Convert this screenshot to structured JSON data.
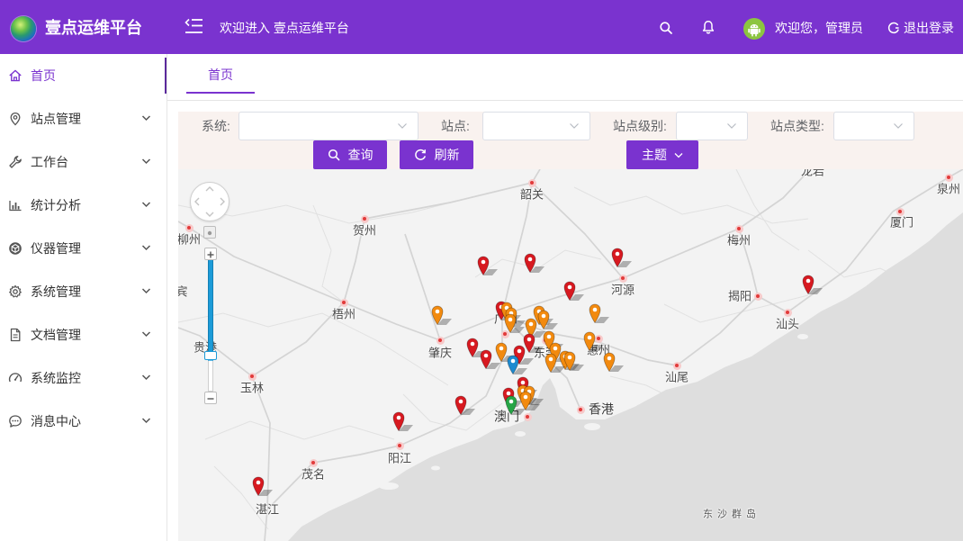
{
  "header": {
    "app_title": "壹点运维平台",
    "welcome_text": "欢迎进入 壹点运维平台",
    "greeting": "欢迎您，管理员",
    "logout_label": "退出登录",
    "icons": {
      "logo": "globe-logo",
      "menu": "menu-toggle-icon",
      "search": "search-icon",
      "notifications": "bell-icon",
      "avatar": "android-avatar",
      "logout": "logout-icon"
    }
  },
  "sidebar": {
    "items": [
      {
        "label": "首页",
        "icon": "home-icon",
        "active": true
      },
      {
        "label": "站点管理",
        "icon": "location-icon"
      },
      {
        "label": "工作台",
        "icon": "wrench-icon"
      },
      {
        "label": "统计分析",
        "icon": "bar-chart-icon"
      },
      {
        "label": "仪器管理",
        "icon": "instrument-icon"
      },
      {
        "label": "系统管理",
        "icon": "gear-icon"
      },
      {
        "label": "文档管理",
        "icon": "document-icon"
      },
      {
        "label": "系统监控",
        "icon": "gauge-icon"
      },
      {
        "label": "消息中心",
        "icon": "chat-icon"
      }
    ]
  },
  "tabs": [
    {
      "label": "首页",
      "active": true
    }
  ],
  "filters": {
    "system": {
      "label": "系统:"
    },
    "station": {
      "label": "站点:"
    },
    "station_level": {
      "label": "站点级别:"
    },
    "station_type": {
      "label": "站点类型:"
    }
  },
  "buttons": {
    "query": "查询",
    "refresh": "刷新",
    "theme": "主题"
  },
  "map": {
    "place_labels": [
      "韶关",
      "龙岩",
      "泉州",
      "厦门",
      "贺州",
      "柳州",
      "梅州",
      "宾",
      "河源",
      "揭阳",
      "汕头",
      "梧州",
      "肇庆",
      "贵港",
      "玉林",
      "汕尾",
      "澳门",
      "香港",
      "阳江",
      "茂名",
      "湛江",
      "东沙群岛",
      "广州",
      "东莞",
      "惠州"
    ]
  },
  "colors": {
    "primary": "#7a33cf",
    "filter_background": "#f9f2ef",
    "marker_red": "#d71920",
    "marker_orange": "#f28a0f",
    "marker_blue": "#1d8ad0",
    "marker_green": "#26a546",
    "zoom_slider": "#1c9bd8"
  }
}
